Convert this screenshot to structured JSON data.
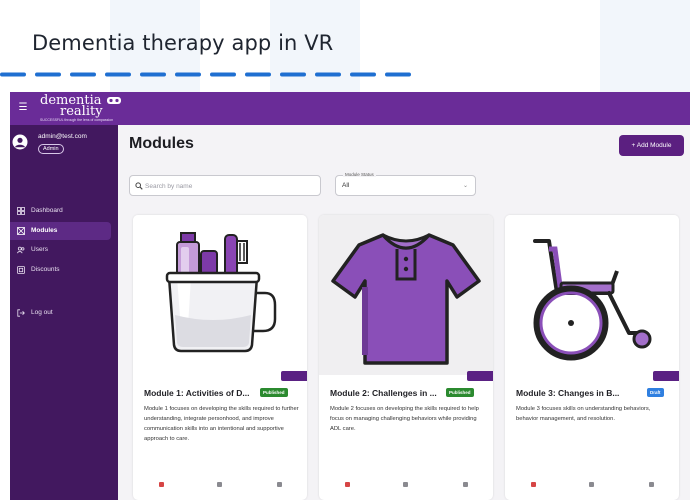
{
  "page": {
    "title": "Dementia therapy app in VR"
  },
  "app": {
    "brand_top": "dementia",
    "brand_bottom": "reality",
    "tagline": "SUCCESSFUL through the lens of compassion",
    "accent_color": "#6a2c98",
    "sidebar_color": "#42185f"
  },
  "user": {
    "email": "admin@test.com",
    "role": "Admin"
  },
  "nav": {
    "dashboard": "Dashboard",
    "modules": "Modules",
    "users": "Users",
    "discounts": "Discounts",
    "logout": "Log out",
    "active": "Modules"
  },
  "main": {
    "title": "Modules",
    "add_button": "+ Add Module",
    "search_placeholder": "Search by name",
    "status_label": "Module Status",
    "status_value": "All"
  },
  "cards": [
    {
      "title": "Module 1: Activities of D...",
      "status": "Published",
      "description": "Module 1 focuses on developing the skills required to further understanding, integrate personhood, and improve communication skills into an intentional and supportive approach to care.",
      "image_icon": "toothbrush-cup-icon"
    },
    {
      "title": "Module 2: Challenges in ...",
      "status": "Published",
      "description": "Module 2 focuses on developing the skills required to help focus on managing challenging behaviors while providing ADL care.",
      "image_icon": "shirt-icon"
    },
    {
      "title": "Module 3: Changes in B...",
      "status": "Draft",
      "description": "Module 3 focuses skills on understanding behaviors, behavior management, and resolution.",
      "image_icon": "wheelchair-icon"
    }
  ]
}
